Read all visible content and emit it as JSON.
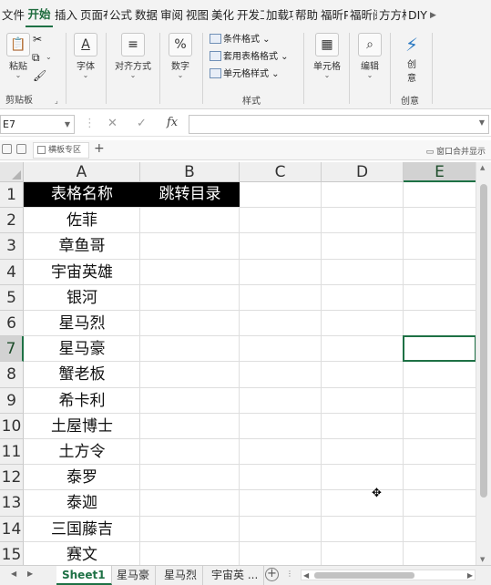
{
  "ribbon_tabs": [
    {
      "label": "文件",
      "active": false
    },
    {
      "label": "开始",
      "active": true
    },
    {
      "label": "插入",
      "active": false
    },
    {
      "label": "页面布",
      "active": false
    },
    {
      "label": "公式",
      "active": false
    },
    {
      "label": "数据",
      "active": false
    },
    {
      "label": "审阅",
      "active": false
    },
    {
      "label": "视图",
      "active": false
    },
    {
      "label": "美化",
      "active": false
    },
    {
      "label": "开发工",
      "active": false
    },
    {
      "label": "加载项",
      "active": false
    },
    {
      "label": "帮助",
      "active": false
    },
    {
      "label": "福昕P",
      "active": false
    },
    {
      "label": "福昕阅",
      "active": false
    },
    {
      "label": "方方格",
      "active": false
    },
    {
      "label": "DIY",
      "active": false
    }
  ],
  "ribbon": {
    "clipboard": {
      "paste": "粘贴",
      "group": "剪贴板"
    },
    "font": {
      "label": "字体"
    },
    "alignment": {
      "label": "对齐方式"
    },
    "number": {
      "label": "数字"
    },
    "styles": {
      "conditional": "条件格式",
      "table_format": "套用表格格式",
      "cell_style": "单元格样式",
      "group": "样式"
    },
    "cells": {
      "label": "单元格"
    },
    "editing": {
      "label": "编辑"
    },
    "creative": {
      "label_top": "创",
      "label_bottom": "意",
      "group": "创意"
    }
  },
  "formula_bar": {
    "name_box": "E7",
    "formula": "",
    "fx": "fx"
  },
  "workbook_tabs": {
    "current": "横板专区",
    "right": "窗口合并显示"
  },
  "columns": [
    "A",
    "B",
    "C",
    "D",
    "E"
  ],
  "selected_column": "E",
  "rows": [
    "1",
    "2",
    "3",
    "4",
    "5",
    "6",
    "7",
    "8",
    "9",
    "10",
    "11",
    "12",
    "13",
    "14",
    "15"
  ],
  "selected_row": "7",
  "selected_cell": "E7",
  "cells": {
    "A1": "表格名称",
    "B1": "跳转目录",
    "A_values": [
      "佐菲",
      "章鱼哥",
      "宇宙英雄",
      "银河",
      "星马烈",
      "星马豪",
      "蟹老板",
      "希卡利",
      "土屋博士",
      "土方令",
      "泰罗",
      "泰迦",
      "三国藤吉",
      "赛文"
    ]
  },
  "sheet_tabs": [
    {
      "label": "Sheet1",
      "active": true
    },
    {
      "label": "星马豪",
      "active": false
    },
    {
      "label": "星马烈",
      "active": false
    },
    {
      "label": "宇宙英 ...",
      "active": false
    }
  ],
  "colors": {
    "accent": "#1e7145",
    "header_fill": "#000000",
    "header_text": "#ffffff"
  }
}
